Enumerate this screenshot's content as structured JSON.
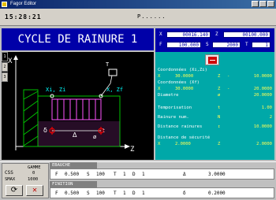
{
  "window": {
    "title": "Fagor Editor"
  },
  "topbar": {
    "clock": "15:28:21",
    "program": "P......"
  },
  "cycle": {
    "title": "CYCLE DE RAINURE 1"
  },
  "side_tabs": [
    "1",
    "2",
    "3"
  ],
  "coords": {
    "x_label": "X",
    "x_value": "00016.140",
    "z_label": "Z",
    "z_value": "00100.000",
    "f_label": "F",
    "f_value": "100.000",
    "s_label": "S",
    "s_value": "2000",
    "t_label": "T",
    "t_value": "1"
  },
  "params": {
    "coord_xi_zi": "Coordonnées (Xi,Zi)",
    "xi_label": "X",
    "xi_value": "30.0000",
    "zi_label": "Z",
    "zi_value": "10.0000",
    "coord_xf_zf": "Coordonnées (Xf)",
    "xf_label": "X",
    "xf_value": "30.0000",
    "zf_label": "Z",
    "zf_value": "20.0000",
    "diametre": "Diametre",
    "diametre_sym": "ø",
    "diametre_value": "20.0000",
    "tempo": "Temporisation",
    "tempo_sym": "t",
    "tempo_value": "1.00",
    "rainure": "Rainure num.",
    "rainure_sym": "N",
    "rainure_value": "2",
    "distance": "Distance rainures",
    "distance_sym": "↕",
    "distance_value": "10.0000",
    "secu": "Distance de sécurité",
    "secu_x_label": "X",
    "secu_x_value": "2.0000",
    "secu_z_label": "Z",
    "secu_z_value": "2.0000"
  },
  "drawing": {
    "x_axis": "X",
    "z_axis": "Z",
    "xi_zi": "Xi, Zi",
    "xf_zf": "X, Zf",
    "delta": "δ",
    "t": "t",
    "delta2": "Δ",
    "diam": "ø",
    "tool": "T"
  },
  "bottom": {
    "css": "CSS",
    "gamme_label": "GAMME",
    "gamme_value": "0",
    "smax_label": "SMAX",
    "smax_value": "1000",
    "ebauche": {
      "header": "EBAUCHE",
      "f_label": "F",
      "f_value": "0.500",
      "s_label": "S",
      "s_value": "100",
      "t_label": "T",
      "t_value": "1",
      "d_label": "D",
      "d_value": "1",
      "delta_label": "Δ",
      "delta_value": "3.0000"
    },
    "finition": {
      "header": "FINITION",
      "f_label": "F",
      "f_value": "0.500",
      "s_label": "S",
      "s_value": "100",
      "t_label": "T",
      "t_value": "1",
      "d_label": "D",
      "d_value": "1",
      "delta_label": "δ",
      "delta_value": "0.2000"
    }
  }
}
